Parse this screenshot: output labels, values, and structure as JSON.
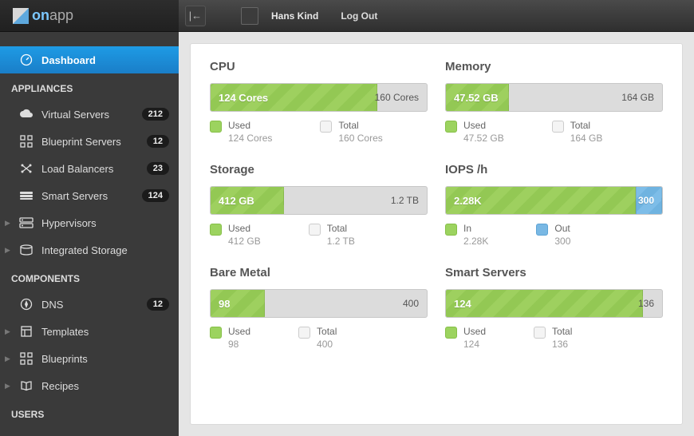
{
  "logo": {
    "part1": "on",
    "part2": "app"
  },
  "topbar": {
    "user": "Hans Kind",
    "logout": "Log Out"
  },
  "sidebar": {
    "dashboard": "Dashboard",
    "sections": [
      {
        "header": "APPLIANCES",
        "items": [
          {
            "label": "Virtual Servers",
            "badge": "212",
            "icon": "cloud",
            "expand": false
          },
          {
            "label": "Blueprint Servers",
            "badge": "12",
            "icon": "blueprint",
            "expand": false
          },
          {
            "label": "Load Balancers",
            "badge": "23",
            "icon": "balance",
            "expand": false
          },
          {
            "label": "Smart Servers",
            "badge": "124",
            "icon": "stack",
            "expand": false
          },
          {
            "label": "Hypervisors",
            "badge": "",
            "icon": "server",
            "expand": true
          },
          {
            "label": "Integrated Storage",
            "badge": "",
            "icon": "storage",
            "expand": true
          }
        ]
      },
      {
        "header": "COMPONENTS",
        "items": [
          {
            "label": "DNS",
            "badge": "12",
            "icon": "compass",
            "expand": false
          },
          {
            "label": "Templates",
            "badge": "",
            "icon": "template",
            "expand": true
          },
          {
            "label": "Blueprints",
            "badge": "",
            "icon": "blueprint",
            "expand": true
          },
          {
            "label": "Recipes",
            "badge": "",
            "icon": "book",
            "expand": true
          }
        ]
      },
      {
        "header": "USERS",
        "items": []
      }
    ]
  },
  "cards": [
    {
      "title": "CPU",
      "lval": "124 Cores",
      "rval": "160 Cores",
      "pct": 77,
      "leg1lab": "Used",
      "leg1val": "124 Cores",
      "leg2lab": "Total",
      "leg2val": "160 Cores",
      "rblue": false
    },
    {
      "title": "Memory",
      "lval": "47.52 GB",
      "rval": "164 GB",
      "pct": 29,
      "leg1lab": "Used",
      "leg1val": "47.52 GB",
      "leg2lab": "Total",
      "leg2val": "164 GB",
      "rblue": false
    },
    {
      "title": "Storage",
      "lval": "412 GB",
      "rval": "1.2 TB",
      "pct": 34,
      "leg1lab": "Used",
      "leg1val": "412 GB",
      "leg2lab": "Total",
      "leg2val": "1.2 TB",
      "rblue": false
    },
    {
      "title": "IOPS /h",
      "lval": "2.28K",
      "rval": "300",
      "pct": 88,
      "leg1lab": "In",
      "leg1val": "2.28K",
      "leg2lab": "Out",
      "leg2val": "300",
      "rblue": true
    },
    {
      "title": "Bare Metal",
      "lval": "98",
      "rval": "400",
      "pct": 25,
      "leg1lab": "Used",
      "leg1val": "98",
      "leg2lab": "Total",
      "leg2val": "400",
      "rblue": false
    },
    {
      "title": "Smart Servers",
      "lval": "124",
      "rval": "136",
      "pct": 91,
      "leg1lab": "Used",
      "leg1val": "124",
      "leg2lab": "Total",
      "leg2val": "136",
      "rblue": false
    }
  ]
}
